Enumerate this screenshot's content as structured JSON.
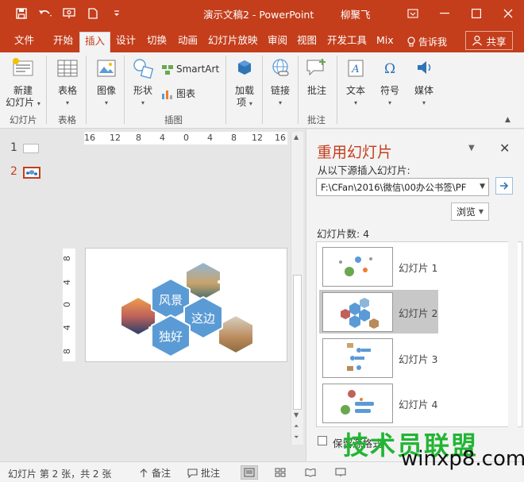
{
  "titlebar": {
    "doc_title": "演示文稿2  -  PowerPoint",
    "user_name": "柳聚飞"
  },
  "tabs": [
    {
      "label": "文件"
    },
    {
      "label": "开始"
    },
    {
      "label": "插入"
    },
    {
      "label": "设计"
    },
    {
      "label": "切换"
    },
    {
      "label": "动画"
    },
    {
      "label": "幻灯片放映"
    },
    {
      "label": "审阅"
    },
    {
      "label": "视图"
    },
    {
      "label": "开发工具"
    },
    {
      "label": "Mix"
    }
  ],
  "tell_me": "告诉我",
  "share": "共享",
  "ribbon": {
    "new_slide_line1": "新建",
    "new_slide_line2": "幻灯片",
    "table": "表格",
    "images": "图像",
    "shapes": "形状",
    "smartart": "SmartArt",
    "chart": "图表",
    "addins_line1": "加载",
    "addins_line2": "项",
    "links": "链接",
    "comment": "批注",
    "text": "文本",
    "symbols": "符号",
    "media": "媒体",
    "groups": {
      "slides": "幻灯片",
      "tables": "表格",
      "illustrations": "插图",
      "comments": "批注"
    }
  },
  "thumbnails": [
    {
      "num": "1"
    },
    {
      "num": "2"
    }
  ],
  "rulers": {
    "horizontal": [
      "16",
      "12",
      "8",
      "4",
      "0",
      "4",
      "8",
      "12",
      "16"
    ],
    "vertical": [
      "8",
      "4",
      "0",
      "4",
      "8"
    ]
  },
  "slide": {
    "hex1": "风景",
    "hex2": "这边",
    "hex3": "独好"
  },
  "reuse_pane": {
    "title": "重用幻灯片",
    "insert_from": "从以下源插入幻灯片:",
    "path": "F:\\CFan\\2016\\微信\\00办公书签\\PF",
    "browse": "浏览",
    "count": "幻灯片数: 4",
    "slides": [
      {
        "label": "幻灯片 1"
      },
      {
        "label": "幻灯片 2"
      },
      {
        "label": "幻灯片 3"
      },
      {
        "label": "幻灯片 4"
      }
    ],
    "keep_format": "保留源格式"
  },
  "statusbar": {
    "slide_info": "幻灯片 第 2 张，共 2 张",
    "notes": "备注",
    "comments": "批注"
  },
  "watermark": {
    "line1": "技术员联盟",
    "line2": "winxp8.com"
  },
  "colors": {
    "accent": "#c43e1c",
    "hex_fill": "#5b9bd5",
    "watermark_green": "#22b534"
  }
}
